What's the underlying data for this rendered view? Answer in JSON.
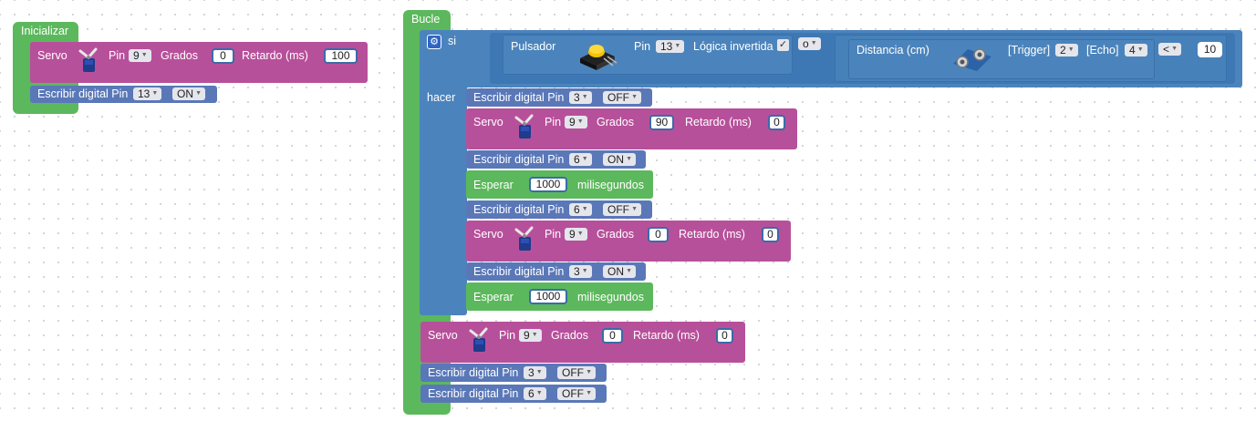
{
  "init": {
    "header": "Inicializar",
    "servo": {
      "label": "Servo",
      "pin_label": "Pin",
      "pin": "9",
      "grados_label": "Grados",
      "grados": "0",
      "retardo_label": "Retardo (ms)",
      "retardo": "100"
    },
    "digital": {
      "label": "Escribir digital Pin",
      "pin": "13",
      "state": "ON"
    }
  },
  "loop": {
    "header": "Bucle",
    "if_label": "si",
    "do_label": "hacer",
    "condition": {
      "button": {
        "label": "Pulsador",
        "pin_label": "Pin",
        "pin": "13",
        "invert_label": "Lógica invertida",
        "invert_checked": true
      },
      "operator": "o",
      "distance": {
        "label": "Distancia (cm)",
        "trigger_label": "[Trigger]",
        "trigger": "2",
        "echo_label": "[Echo]",
        "echo": "4",
        "compare": "<",
        "value": "10"
      }
    },
    "do_blocks": [
      {
        "type": "digital",
        "label": "Escribir digital Pin",
        "pin": "3",
        "state": "OFF"
      },
      {
        "type": "servo",
        "label": "Servo",
        "pin_label": "Pin",
        "pin": "9",
        "grados_label": "Grados",
        "grados": "90",
        "retardo_label": "Retardo (ms)",
        "retardo": "0"
      },
      {
        "type": "digital",
        "label": "Escribir digital Pin",
        "pin": "6",
        "state": "ON"
      },
      {
        "type": "wait",
        "label": "Esperar",
        "value": "1000",
        "unit": "milisegundos"
      },
      {
        "type": "digital",
        "label": "Escribir digital Pin",
        "pin": "6",
        "state": "OFF"
      },
      {
        "type": "servo",
        "label": "Servo",
        "pin_label": "Pin",
        "pin": "9",
        "grados_label": "Grados",
        "grados": "0",
        "retardo_label": "Retardo (ms)",
        "retardo": "0"
      },
      {
        "type": "digital",
        "label": "Escribir digital Pin",
        "pin": "3",
        "state": "ON"
      },
      {
        "type": "wait",
        "label": "Esperar",
        "value": "1000",
        "unit": "milisegundos"
      }
    ],
    "after_blocks": [
      {
        "type": "servo",
        "label": "Servo",
        "pin_label": "Pin",
        "pin": "9",
        "grados_label": "Grados",
        "grados": "0",
        "retardo_label": "Retardo (ms)",
        "retardo": "0"
      },
      {
        "type": "digital",
        "label": "Escribir digital Pin",
        "pin": "3",
        "state": "OFF"
      },
      {
        "type": "digital",
        "label": "Escribir digital Pin",
        "pin": "6",
        "state": "OFF"
      }
    ]
  },
  "colors": {
    "control": "#5cb85c",
    "servo": "#b7509a",
    "digital": "#5a78b8",
    "logic": "#4b84bc",
    "workspace": "#ffffff"
  },
  "icons": {
    "servo": "servo-motor-icon",
    "button": "push-button-icon",
    "distance": "ultrasonic-sensor-icon",
    "gear": "gear-icon"
  }
}
